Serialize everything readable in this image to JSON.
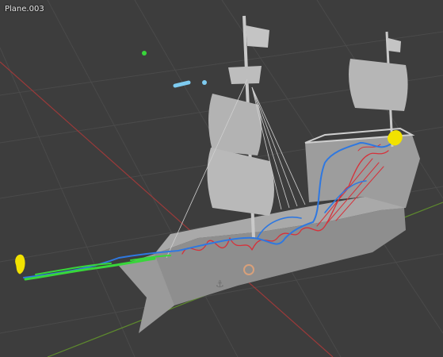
{
  "viewport": {
    "active_object_label": "Plane.003"
  },
  "colors": {
    "background": "#3d3d3d",
    "grid": "#4a4a4a",
    "axis_x": "#9b3a3a",
    "axis_y": "#5e8a2e",
    "ship_light": "#b9b9b9",
    "ship_mid": "#8e8e8e",
    "ship_dark": "#6b6b6b",
    "stroke_red": "#d6313a",
    "stroke_blue": "#2f78e0",
    "stroke_green": "#38d63a",
    "stroke_yellow": "#f2e200",
    "stroke_cyan": "#7ecbf0"
  }
}
